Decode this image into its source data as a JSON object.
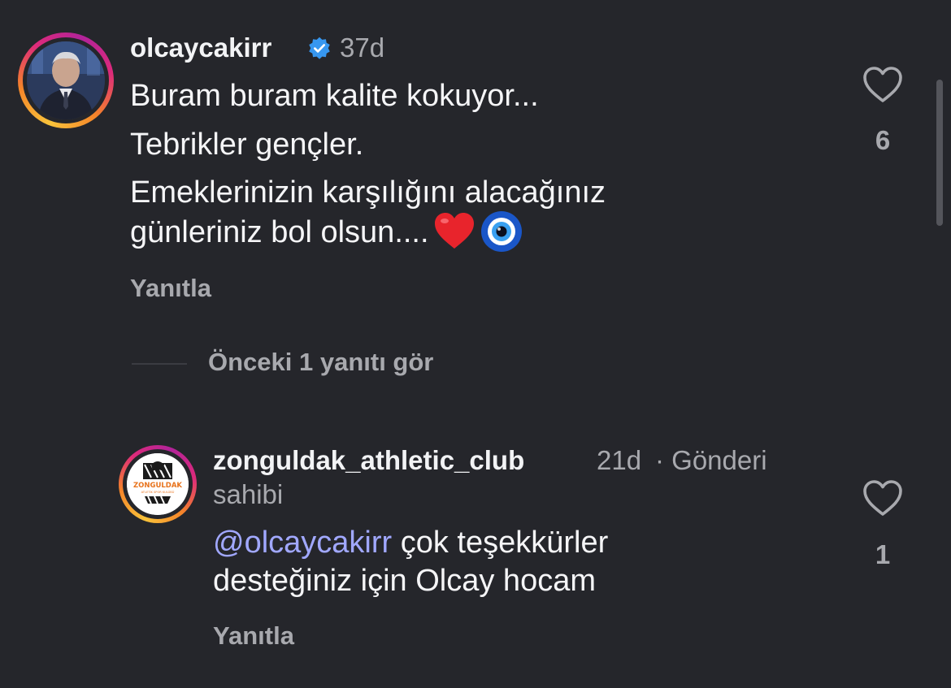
{
  "comments": [
    {
      "username": "olcaycakirr",
      "verified": true,
      "time": "37d",
      "lines": [
        "Buram buram kalite kokuyor...",
        "Tebrikler gençler.",
        "Emeklerinizin karşılığını alacağınız",
        "günleriniz bol olsun...."
      ],
      "emojis": [
        "heart-emoji",
        "evil-eye-emoji"
      ],
      "reply_label": "Yanıtla",
      "like_count": "6"
    },
    {
      "username": "zonguldak_athletic_club",
      "time": "21d",
      "meta_line1": "· Gönderi",
      "meta_line2": "sahibi",
      "mention": "@olcaycakirr",
      "line1_rest": " çok teşekkürler",
      "line2": "desteğiniz için Olcay hocam",
      "reply_label": "Yanıtla",
      "like_count": "1",
      "avatar_logo_text": "ZONGULDAK",
      "avatar_logo_subtext": "ATLETİK SPOR KULÜBÜ"
    }
  ],
  "replies_toggle": "Önceki 1 yanıtı gör",
  "colors": {
    "background": "#25262b",
    "text": "#f5f5f7",
    "secondary": "#a8a9ae",
    "mention": "#a1a8ff",
    "verified": "#3797f0"
  }
}
